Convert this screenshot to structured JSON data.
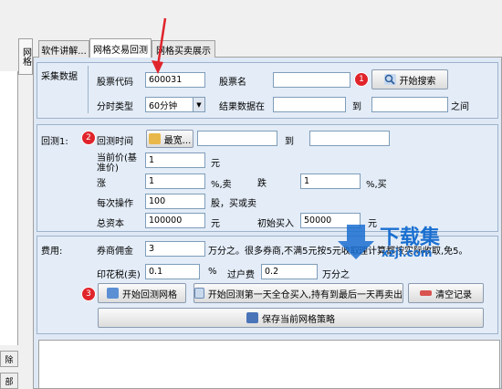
{
  "tabs": [
    {
      "label": "软件讲解..."
    },
    {
      "label": "网格交易回测"
    },
    {
      "label": "网格买卖展示"
    }
  ],
  "vertical_tab": "网格",
  "collect": {
    "group_label": "采集数据",
    "stock_code_label": "股票代码",
    "stock_code_value": "600031",
    "stock_name_label": "股票名",
    "stock_name_value": "",
    "search_button": "开始搜索",
    "period_label": "分时类型",
    "period_value": "60分钟",
    "result_label": "结果数据在",
    "to_label": "到",
    "between_label": "之间"
  },
  "backtest": {
    "group_label": "回测1:",
    "time_label": "回测时间",
    "latest_button": "最宽...",
    "to_label": "到",
    "price_label": "当前价(基准价)",
    "price_value": "1",
    "price_unit": "元",
    "rise_label": "涨",
    "rise_value": "1",
    "rise_unit": "%,卖",
    "fall_label": "跌",
    "fall_value": "1",
    "fall_unit": "%,买",
    "op_label": "每次操作",
    "op_value": "100",
    "op_unit": "股，买或卖",
    "capital_label": "总资本",
    "capital_value": "100000",
    "capital_unit": "元",
    "initial_label": "初始买入",
    "initial_value": "50000",
    "initial_unit": "元"
  },
  "fees": {
    "group_label": "费用:",
    "commission_label": "券商佣金",
    "commission_value": "3",
    "commission_note": "万分之。很多券商,不满5元按5元收取,",
    "commission_note2": "理计算都按实际收取,免5。",
    "stamp_label": "印花税(卖)",
    "stamp_value": "0.1",
    "stamp_unit": "%",
    "transfer_label": "过户费",
    "transfer_value": "0.2",
    "transfer_unit": "万分之"
  },
  "actions": {
    "start_button": "开始回测网格",
    "fullbuy_button": "开始回测第一天全仓买入,持有到最后一天再卖出",
    "clear_button": "清空记录",
    "save_button": "保存当前网格策略"
  },
  "badges": [
    "1",
    "2",
    "3"
  ],
  "left_side_buttons": [
    "除",
    "部"
  ],
  "watermark": {
    "title": "下载集",
    "url": "xzji.com"
  },
  "colors": {
    "badge": "#e0242b",
    "arrow": "#e0242b",
    "accent": "#1a6fd0"
  }
}
